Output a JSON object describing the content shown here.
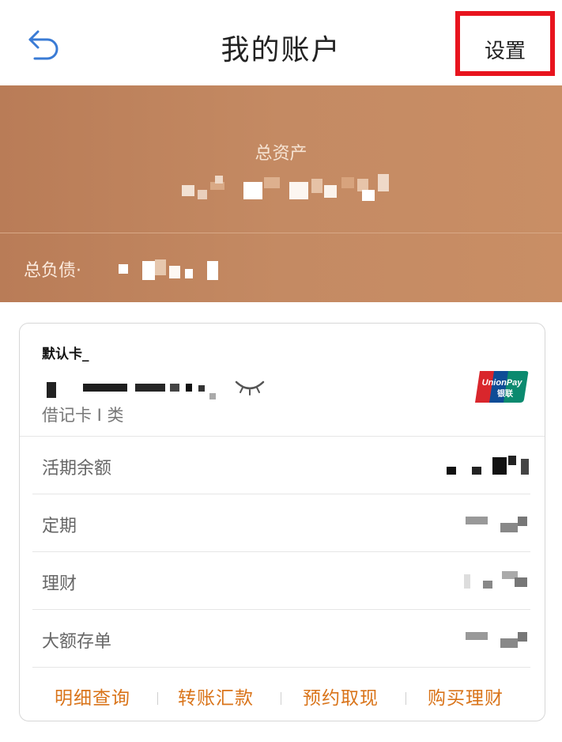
{
  "header": {
    "back_icon": "back-arrow-icon",
    "title": "我的账户",
    "settings_label": "设置",
    "highlight_color": "#e8141e"
  },
  "banner": {
    "total_assets_label": "总资产",
    "total_debt_label": "总负债·",
    "background_color": "#c08762"
  },
  "card": {
    "default_label": "默认卡_",
    "card_type": "借记卡 I 类",
    "eye_icon": "eye-closed-icon",
    "brand_icon": "unionpay-logo",
    "rows": [
      {
        "label": "活期余额"
      },
      {
        "label": "定期"
      },
      {
        "label": "理财"
      },
      {
        "label": "大额存单"
      }
    ],
    "actions": [
      {
        "label": "明细查询"
      },
      {
        "label": "转账汇款"
      },
      {
        "label": "预约取现"
      },
      {
        "label": "购买理财"
      }
    ],
    "accent_color": "#d9741a"
  }
}
